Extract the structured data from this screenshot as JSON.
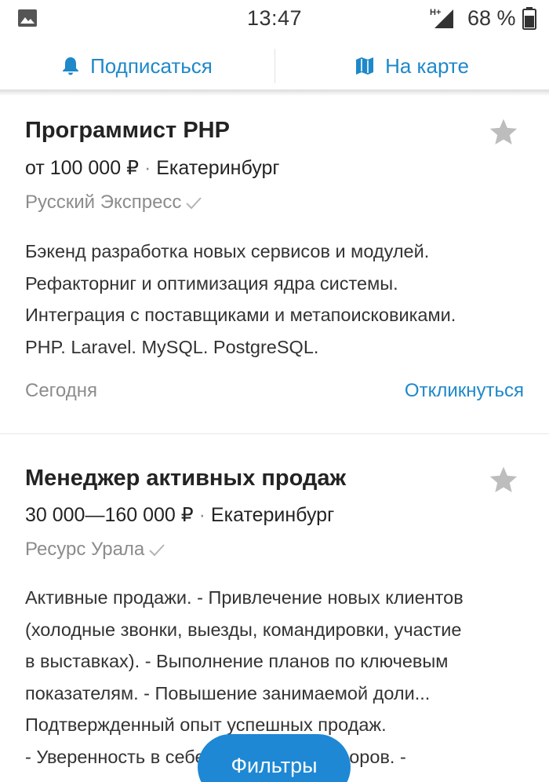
{
  "status_bar": {
    "time": "13:47",
    "network": "H+",
    "battery_percent": "68 %",
    "icons": [
      "gallery-icon",
      "signal-icon",
      "battery-icon"
    ]
  },
  "action_bar": {
    "subscribe_label": "Подписаться",
    "map_label": "На карте",
    "icons": [
      "bell-icon",
      "map-icon"
    ],
    "accent_color": "#1e88c9"
  },
  "vacancies": [
    {
      "title": "Программист PHP",
      "salary": "от 100 000 ₽",
      "separator": "·",
      "city": "Екатеринбург",
      "company": "Русский Экспресс",
      "description": [
        "Бэкенд разработка новых сервисов и модулей.",
        "Рефакторниг и оптимизация ядра системы.",
        "Интеграция с поставщиками и метапоисковиками.",
        "PHP. Laravel. MySQL. PostgreSQL."
      ],
      "date": "Сегодня",
      "respond_label": "Откликнуться"
    },
    {
      "title": "Менеджер активных продаж",
      "salary": "30 000—160 000 ₽",
      "separator": "·",
      "city": "Екатеринбург",
      "company": "Ресурс Урала",
      "description": [
        "Активные продажи. - Привлечение новых клиентов",
        "(холодные звонки, выезды, командировки, участие",
        "в выставках). - Выполнение планов по ключевым",
        "показателям. - Повышение занимаемой доли...",
        "Подтвержденный опыт успешных продаж.",
        "- Уверенность в себе, навыки переговоров. -"
      ]
    }
  ],
  "filters_label": "Фильтры",
  "colors": {
    "primary": "#1e88d4",
    "muted_text": "#8c8c8c",
    "star": "#bdbdbd"
  }
}
